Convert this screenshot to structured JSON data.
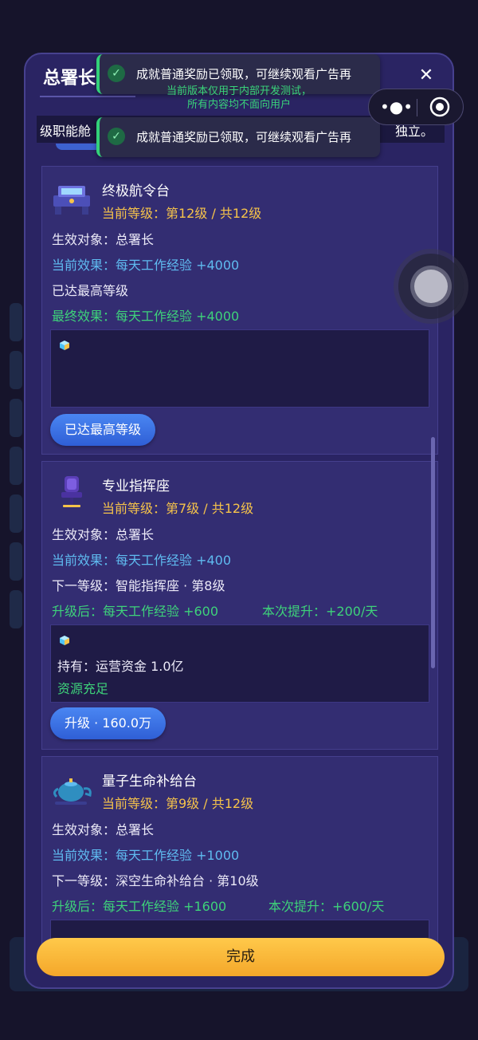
{
  "modal": {
    "title": "总署长",
    "close_label": "✕",
    "subtitle_left": "级职能舱",
    "subtitle_right": "独立。",
    "done_label": "完成"
  },
  "toasts": [
    {
      "text": "成就普通奖励已领取，可继续观看广告再"
    },
    {
      "text": "成就普通奖励已领取，可继续观看广告再"
    }
  ],
  "dev_note": {
    "line1": "当前版本仅用于内部开发测试，",
    "line2": "所有内容均不面向用户"
  },
  "capsule": {
    "more_label": "•●•"
  },
  "cards": [
    {
      "name": "终极航令台",
      "level": "当前等级：第12级 / 共12级",
      "target": "生效对象：总署长",
      "current_effect": "当前效果：每天工作经验 +4000",
      "status": "已达最高等级",
      "final_effect": "最终效果：每天工作经验 +4000",
      "button": "已达最高等级"
    },
    {
      "name": "专业指挥座",
      "level": "当前等级：第7级 / 共12级",
      "target": "生效对象：总署长",
      "current_effect": "当前效果：每天工作经验 +400",
      "next_level": "下一等级：智能指挥座 · 第8级",
      "after_upgrade": "升级后：每天工作经验 +600",
      "boost": "本次提升：+200/天",
      "holding": "持有：运营资金 1.0亿",
      "sufficient": "资源充足",
      "button": "升级 · 160.0万"
    },
    {
      "name": "量子生命补给台",
      "level": "当前等级：第9级 / 共12级",
      "target": "生效对象：总署长",
      "current_effect": "当前效果：每天工作经验 +1000",
      "next_level": "下一等级：深空生命补给台 · 第10级",
      "after_upgrade": "升级后：每天工作经验 +1600",
      "boost": "本次提升：+600/天"
    }
  ],
  "colors": {
    "accent_gold": "#f6c34a",
    "effect_blue": "#5fbbf0",
    "positive_green": "#3ed27a",
    "button_blue": "#3d6fe0",
    "done_yellow": "#f8b83a"
  }
}
